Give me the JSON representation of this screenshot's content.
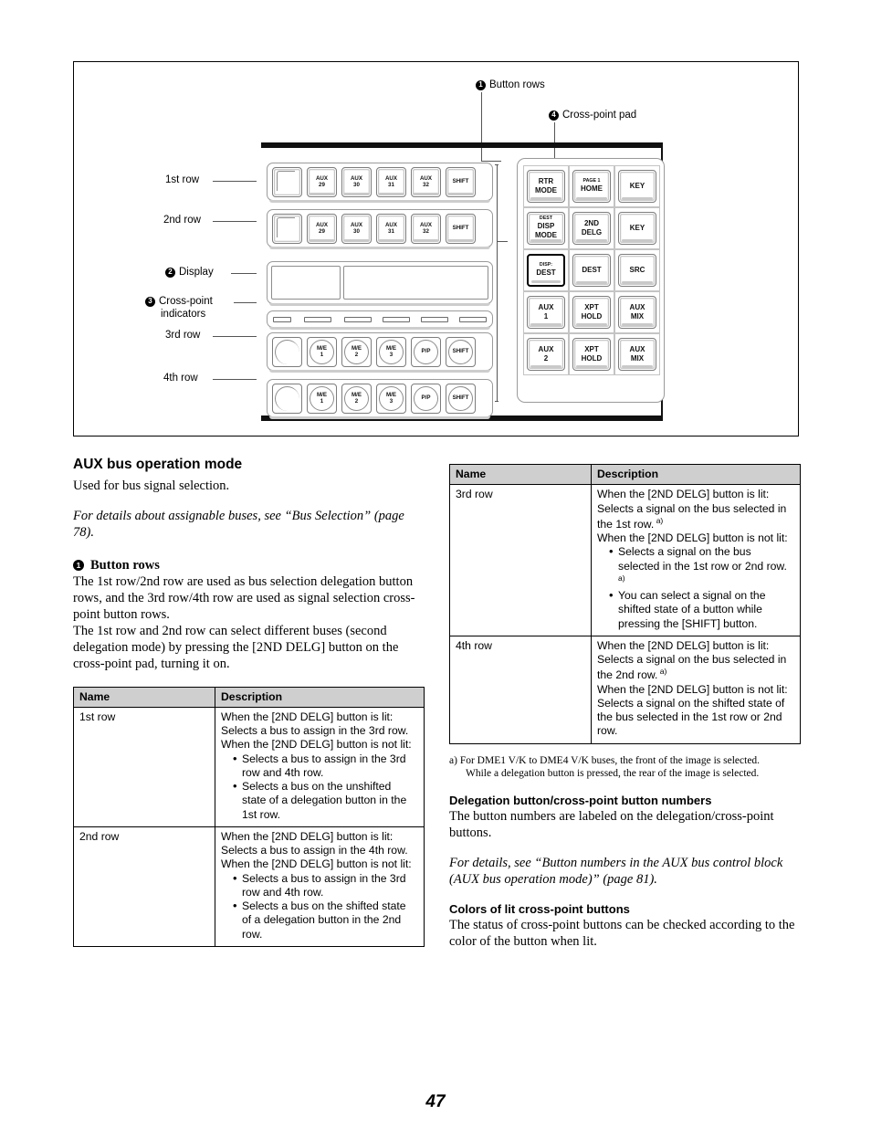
{
  "figure": {
    "callouts": [
      {
        "num": "1",
        "label": "Button rows"
      },
      {
        "num": "4",
        "label": "Cross-point pad"
      },
      {
        "num": "2",
        "label": "Display"
      },
      {
        "num": "3",
        "label": "Cross-point"
      },
      {
        "num": "3b",
        "label": "indicators"
      }
    ],
    "row_labels": {
      "first": "1st row",
      "second": "2nd row",
      "third": "3rd row",
      "fourth": "4th row"
    },
    "button_rows": {
      "row1": [
        {
          "line1": "",
          "line2": "",
          "blank": true
        },
        {
          "line1": "AUX",
          "line2": "29"
        },
        {
          "line1": "AUX",
          "line2": "30"
        },
        {
          "line1": "AUX",
          "line2": "31"
        },
        {
          "line1": "AUX",
          "line2": "32"
        },
        {
          "line1": "SHIFT",
          "line2": ""
        }
      ],
      "row2": [
        {
          "line1": "",
          "line2": "",
          "blank": true
        },
        {
          "line1": "AUX",
          "line2": "29"
        },
        {
          "line1": "AUX",
          "line2": "30"
        },
        {
          "line1": "AUX",
          "line2": "31"
        },
        {
          "line1": "AUX",
          "line2": "32"
        },
        {
          "line1": "SHIFT",
          "line2": ""
        }
      ],
      "row3": [
        {
          "line1": "",
          "line2": "",
          "blank": true
        },
        {
          "line1": "M/E",
          "line2": "1"
        },
        {
          "line1": "M/E",
          "line2": "2"
        },
        {
          "line1": "M/E",
          "line2": "3"
        },
        {
          "line1": "P/P",
          "line2": ""
        },
        {
          "line1": "SHIFT",
          "line2": ""
        }
      ],
      "row4": [
        {
          "line1": "",
          "line2": "",
          "blank": true
        },
        {
          "line1": "M/E",
          "line2": "1"
        },
        {
          "line1": "M/E",
          "line2": "2"
        },
        {
          "line1": "M/E",
          "line2": "3"
        },
        {
          "line1": "P/P",
          "line2": ""
        },
        {
          "line1": "SHIFT",
          "line2": ""
        }
      ]
    },
    "crosspoint_pad": [
      {
        "sup": "",
        "line1": "RTR",
        "line2": "MODE",
        "selected": false
      },
      {
        "sup": "PAGE 1",
        "line1": "HOME",
        "line2": "",
        "selected": false
      },
      {
        "sup": "",
        "line1": "KEY",
        "line2": "",
        "selected": false
      },
      {
        "sup": "DEST",
        "line1": "DISP",
        "line2": "MODE",
        "selected": false
      },
      {
        "sup": "",
        "line1": "2ND",
        "line2": "DELG",
        "selected": false
      },
      {
        "sup": "",
        "line1": "KEY",
        "line2": "",
        "selected": false
      },
      {
        "sup": "DISP:",
        "line1": "DEST",
        "line2": "",
        "selected": true
      },
      {
        "sup": "",
        "line1": "DEST",
        "line2": "",
        "selected": false
      },
      {
        "sup": "",
        "line1": "SRC",
        "line2": "",
        "selected": false
      },
      {
        "sup": "",
        "line1": "AUX",
        "line2": "1",
        "selected": false
      },
      {
        "sup": "",
        "line1": "XPT",
        "line2": "HOLD",
        "selected": false
      },
      {
        "sup": "",
        "line1": "AUX",
        "line2": "MIX",
        "selected": false
      },
      {
        "sup": "",
        "line1": "AUX",
        "line2": "2",
        "selected": false
      },
      {
        "sup": "",
        "line1": "XPT",
        "line2": "HOLD",
        "selected": false
      },
      {
        "sup": "",
        "line1": "AUX",
        "line2": "MIX",
        "selected": false
      }
    ]
  },
  "left_column": {
    "section_title": "AUX bus operation mode",
    "intro": "Used for bus signal selection.",
    "reference": "For details about assignable buses, see “Bus Selection” (page 78).",
    "heading_num": "1",
    "heading_text": "Button rows",
    "paragraph1": "The 1st row/2nd row are used as bus selection delegation button rows, and the 3rd row/4th row are used as signal selection cross-point button rows.",
    "paragraph2": "The 1st row and 2nd row can select different buses (second delegation mode) by pressing the [2ND DELG] button on the cross-point pad, turning it on."
  },
  "table_left": {
    "headers": {
      "name": "Name",
      "description": "Description"
    },
    "rows": [
      {
        "name": "1st row",
        "lines": [
          "When the [2ND DELG] button is lit:",
          "Selects a bus to assign in the 3rd row.",
          "When the [2ND DELG] button is not lit:"
        ],
        "bullets": [
          "Selects a bus to assign in the 3rd row and 4th row.",
          "Selects a bus on the unshifted state of a delegation button in the 1st row."
        ]
      },
      {
        "name": "2nd row",
        "lines": [
          "When the [2ND DELG] button is lit:",
          "Selects a bus to assign in the 4th row.",
          "When the [2ND DELG] button is not lit:"
        ],
        "bullets": [
          "Selects a bus to assign in the 3rd row and 4th row.",
          "Selects a bus on the shifted state of a delegation button in the 2nd row."
        ]
      }
    ]
  },
  "table_right": {
    "headers": {
      "name": "Name",
      "description": "Description"
    },
    "rows": [
      {
        "name": "3rd row",
        "line1": "When the [2ND DELG] button is lit:",
        "line2a": "Selects a signal on the bus selected in the 1st row.",
        "line2_sup": "a)",
        "line3": "When the [2ND DELG] button is not lit:",
        "bullet1a": "Selects a signal on the bus selected in the 1st row or 2nd row.",
        "bullet1_sup": "a)",
        "bullet2": "You can select a signal on the shifted state of a button while pressing the [SHIFT] button."
      },
      {
        "name": "4th row",
        "line1": "When the [2ND DELG] button is lit:",
        "line2a": "Selects a signal on the bus selected in the 2nd row.",
        "line2_sup": "a)",
        "line3": "When the [2ND DELG] button is not lit:",
        "line4": "Selects a signal on the shifted state of the bus selected in the 1st row or 2nd row."
      }
    ]
  },
  "right_column": {
    "footnote_marker": "a)",
    "footnote_line1": "For DME1 V/K to DME4 V/K buses, the front of the image is selected.",
    "footnote_line2": "While a delegation button is pressed, the rear of the image is selected.",
    "heading_delegation": "Delegation button/cross-point button numbers",
    "para_delegation": "The button numbers are labeled on the delegation/cross-point buttons.",
    "reference": "For details, see “Button numbers in the AUX bus control block (AUX bus operation mode)” (page 81).",
    "heading_colors": "Colors of lit cross-point buttons",
    "para_colors": "The status of cross-point buttons can be checked according to the color of the button when lit."
  },
  "footer": {
    "page_number": "47"
  }
}
